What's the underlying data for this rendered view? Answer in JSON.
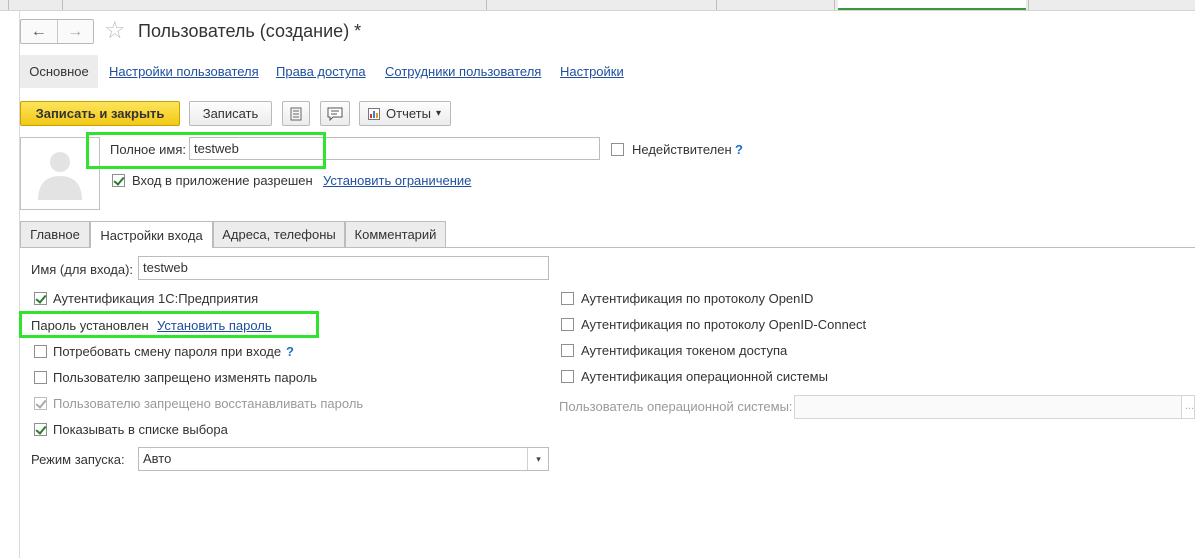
{
  "window": {
    "title": "Пользователь (создание) *"
  },
  "nav": {
    "back_icon": "←",
    "forward_icon": "→",
    "star_icon": "☆"
  },
  "top_tabs": [
    {
      "label": "Основное",
      "active": true
    },
    {
      "label": "Настройки пользователя"
    },
    {
      "label": "Права доступа"
    },
    {
      "label": "Сотрудники пользователя"
    },
    {
      "label": "Настройки"
    }
  ],
  "toolbar": {
    "save_close": "Записать и закрыть",
    "save": "Записать",
    "reports": "Отчеты",
    "dropdown_arrow": "▾"
  },
  "header": {
    "fullname_label": "Полное имя:",
    "fullname_value": "testweb",
    "invalid_label": "Недействителен",
    "help": "?",
    "login_allowed_label": "Вход в приложение разрешен",
    "set_restriction_link": "Установить ограничение"
  },
  "form_tabs": [
    {
      "label": "Главное"
    },
    {
      "label": "Настройки входа",
      "active": true
    },
    {
      "label": "Адреса, телефоны"
    },
    {
      "label": "Комментарий"
    }
  ],
  "login": {
    "name_label": "Имя (для входа):",
    "name_value": "testweb",
    "auth_1c": "Аутентификация 1С:Предприятия",
    "password_set": "Пароль установлен",
    "set_password_link": "Установить пароль",
    "require_change": "Потребовать смену пароля при входе",
    "help": "?",
    "forbid_change": "Пользователю запрещено изменять пароль",
    "forbid_restore": "Пользователю запрещено восстанавливать пароль",
    "show_in_list": "Показывать в списке выбора",
    "launch_mode_label": "Режим запуска:",
    "launch_mode_value": "Авто",
    "openid": "Аутентификация по протоколу OpenID",
    "openid_connect": "Аутентификация по протоколу OpenID-Connect",
    "token": "Аутентификация токеном доступа",
    "os_auth": "Аутентификация операционной системы",
    "os_user_label": "Пользователь операционной системы:",
    "os_user_value": "",
    "os_user_button": "..."
  },
  "colors": {
    "highlight": "#2fe32f",
    "primary_button": "#f3c917",
    "link": "#1f4f9e"
  }
}
